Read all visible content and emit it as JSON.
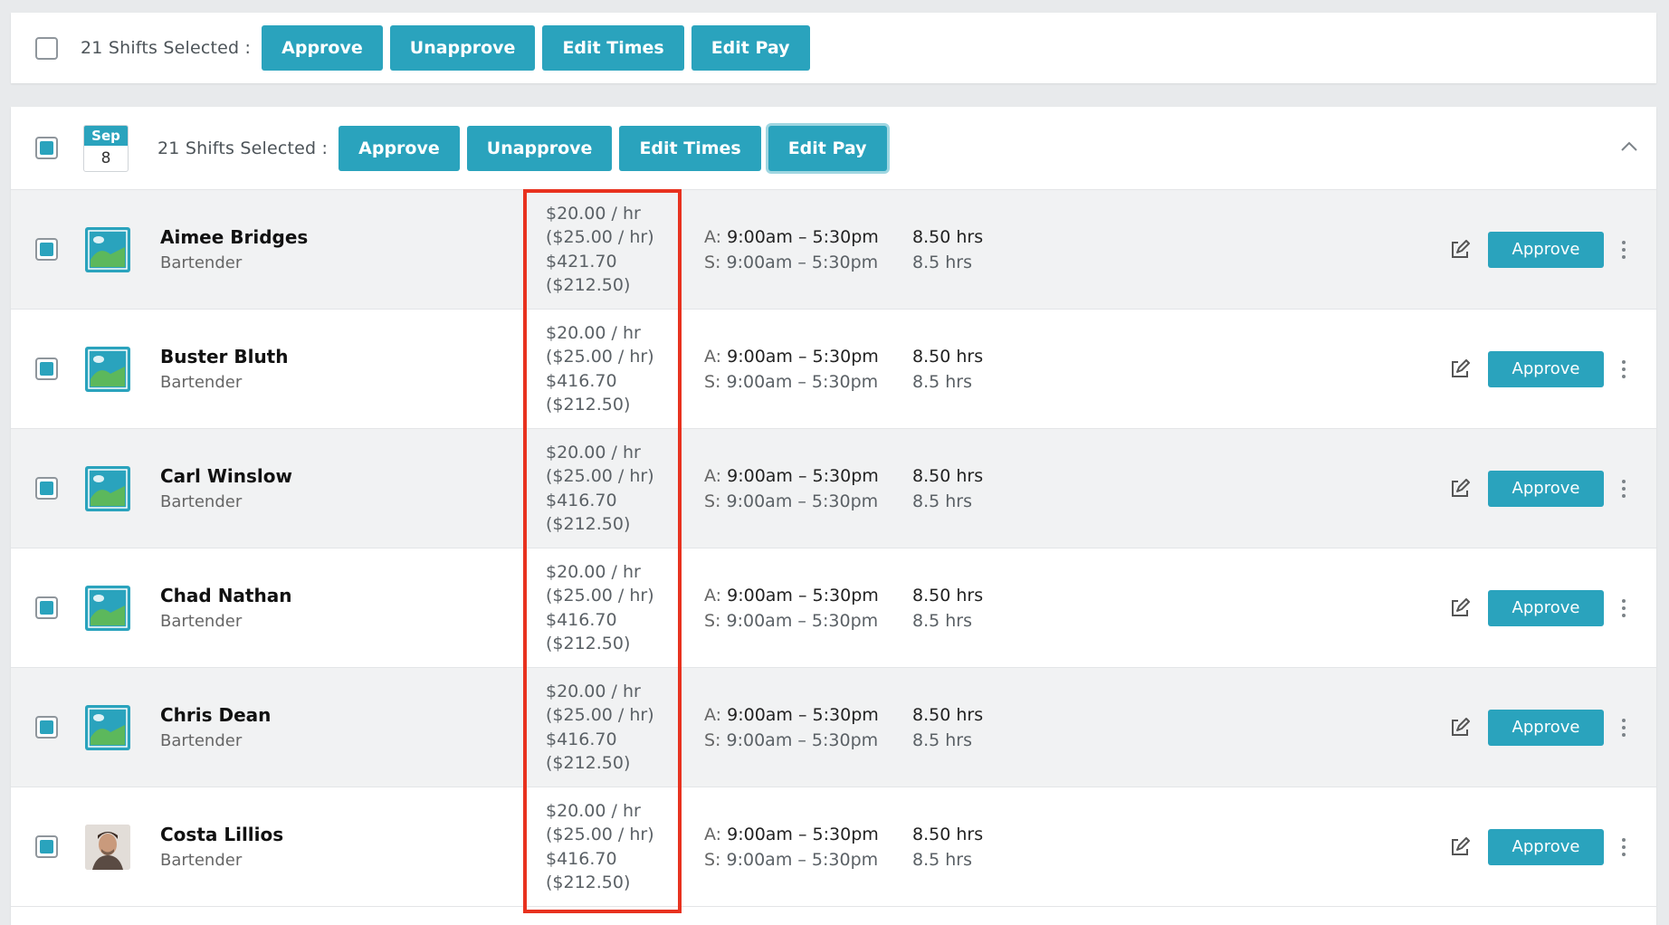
{
  "bulk_bar": {
    "selected_label": "21 Shifts Selected :",
    "buttons": {
      "approve": "Approve",
      "unapprove": "Unapprove",
      "edit_times": "Edit Times",
      "edit_pay": "Edit Pay"
    }
  },
  "group": {
    "date": {
      "month": "Sep",
      "day": "8"
    },
    "selected_label": "21 Shifts Selected :",
    "buttons": {
      "approve": "Approve",
      "unapprove": "Unapprove",
      "edit_times": "Edit Times",
      "edit_pay": "Edit Pay"
    },
    "collapse_icon": "chevron-up-icon"
  },
  "rows": [
    {
      "name": "Aimee Bridges",
      "role": "Bartender",
      "avatar": "image-placeholder-icon",
      "rate": "$20.00 / hr",
      "rate_alt": "($25.00 / hr)",
      "total": "$421.70",
      "total_alt": "($212.50)",
      "actual_label": "A:",
      "actual_time": "9:00am – 5:30pm",
      "scheduled_label": "S:",
      "scheduled_time": "9:00am – 5:30pm",
      "actual_hours": "8.50 hrs",
      "scheduled_hours": "8.5 hrs",
      "approve_label": "Approve"
    },
    {
      "name": "Buster Bluth",
      "role": "Bartender",
      "avatar": "image-placeholder-icon",
      "rate": "$20.00 / hr",
      "rate_alt": "($25.00 / hr)",
      "total": "$416.70",
      "total_alt": "($212.50)",
      "actual_label": "A:",
      "actual_time": "9:00am – 5:30pm",
      "scheduled_label": "S:",
      "scheduled_time": "9:00am – 5:30pm",
      "actual_hours": "8.50 hrs",
      "scheduled_hours": "8.5 hrs",
      "approve_label": "Approve"
    },
    {
      "name": "Carl Winslow",
      "role": "Bartender",
      "avatar": "image-placeholder-icon",
      "rate": "$20.00 / hr",
      "rate_alt": "($25.00 / hr)",
      "total": "$416.70",
      "total_alt": "($212.50)",
      "actual_label": "A:",
      "actual_time": "9:00am – 5:30pm",
      "scheduled_label": "S:",
      "scheduled_time": "9:00am – 5:30pm",
      "actual_hours": "8.50 hrs",
      "scheduled_hours": "8.5 hrs",
      "approve_label": "Approve"
    },
    {
      "name": "Chad Nathan",
      "role": "Bartender",
      "avatar": "image-placeholder-icon",
      "rate": "$20.00 / hr",
      "rate_alt": "($25.00 / hr)",
      "total": "$416.70",
      "total_alt": "($212.50)",
      "actual_label": "A:",
      "actual_time": "9:00am – 5:30pm",
      "scheduled_label": "S:",
      "scheduled_time": "9:00am – 5:30pm",
      "actual_hours": "8.50 hrs",
      "scheduled_hours": "8.5 hrs",
      "approve_label": "Approve"
    },
    {
      "name": "Chris Dean",
      "role": "Bartender",
      "avatar": "image-placeholder-icon",
      "rate": "$20.00 / hr",
      "rate_alt": "($25.00 / hr)",
      "total": "$416.70",
      "total_alt": "($212.50)",
      "actual_label": "A:",
      "actual_time": "9:00am – 5:30pm",
      "scheduled_label": "S:",
      "scheduled_time": "9:00am – 5:30pm",
      "actual_hours": "8.50 hrs",
      "scheduled_hours": "8.5 hrs",
      "approve_label": "Approve"
    },
    {
      "name": "Costa Lillios",
      "role": "Bartender",
      "avatar": "profile-photo",
      "rate": "$20.00 / hr",
      "rate_alt": "($25.00 / hr)",
      "total": "$416.70",
      "total_alt": "($212.50)",
      "actual_label": "A:",
      "actual_time": "9:00am – 5:30pm",
      "scheduled_label": "S:",
      "scheduled_time": "9:00am – 5:30pm",
      "actual_hours": "8.50 hrs",
      "scheduled_hours": "8.5 hrs",
      "approve_label": "Approve"
    }
  ],
  "colors": {
    "accent": "#2aa3bd",
    "highlight": "#e8321f"
  }
}
